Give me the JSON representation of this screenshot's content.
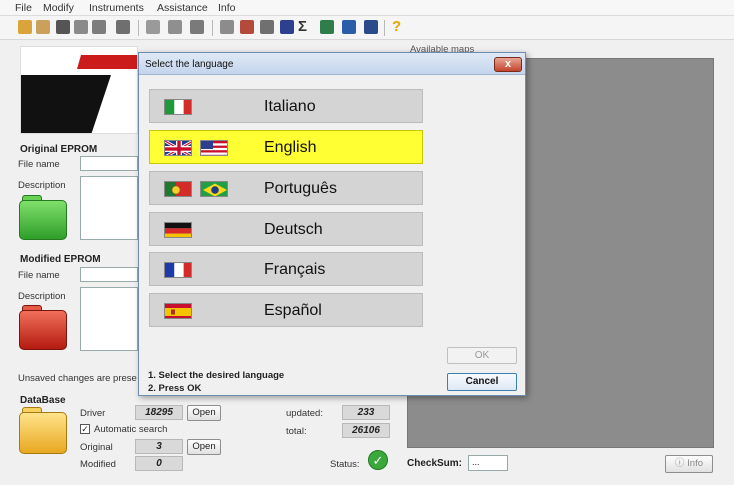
{
  "menu": {
    "file": "File",
    "modify": "Modify",
    "instruments": "Instruments",
    "assistance": "Assistance",
    "info": "Info"
  },
  "toolbar": {
    "icons": [
      "open-folder",
      "open-folder-2",
      "save",
      "grid-view",
      "hex-view",
      "tools",
      "window",
      "table",
      "copy",
      "compare",
      "eraser",
      "calculator",
      "uk-flag",
      "sigma",
      "book",
      "id-card",
      "shield",
      "help"
    ],
    "sigma_label": "Σ",
    "help_label": "?"
  },
  "original_eprom": {
    "title": "Original EPROM",
    "file_name_label": "File name",
    "description_label": "Description"
  },
  "modified_eprom": {
    "title": "Modified EPROM",
    "file_name_label": "File name",
    "description_label": "Description"
  },
  "unsaved_text": "Unsaved changes are prese",
  "database": {
    "title": "DataBase",
    "driver_label": "Driver",
    "driver_value": "18295",
    "open_label": "Open",
    "automatic_search_label": "Automatic search",
    "automatic_search_checked": true,
    "original_label": "Original",
    "original_value": "3",
    "modified_label": "Modified",
    "modified_value": "0",
    "updated_label": "updated:",
    "updated_value": "233",
    "total_label": "total:",
    "total_value": "26106",
    "status_label": "Status:"
  },
  "maps": {
    "label": "Available maps"
  },
  "checksum": {
    "label": "CheckSum:",
    "value": "..."
  },
  "info_button_label": "Info",
  "dialog": {
    "title": "Select the language",
    "close_label": "x",
    "languages": [
      {
        "label": "Italiano",
        "flags": [
          "italy"
        ],
        "selected": false
      },
      {
        "label": "English",
        "flags": [
          "uk",
          "usa"
        ],
        "selected": true
      },
      {
        "label": "Português",
        "flags": [
          "portugal",
          "brazil"
        ],
        "selected": false
      },
      {
        "label": "Deutsch",
        "flags": [
          "germany"
        ],
        "selected": false
      },
      {
        "label": "Français",
        "flags": [
          "france"
        ],
        "selected": false
      },
      {
        "label": "Español",
        "flags": [
          "spain"
        ],
        "selected": false
      }
    ],
    "instructions": [
      "1. Select the desired language",
      "2. Press OK"
    ],
    "ok_label": "OK",
    "cancel_label": "Cancel"
  },
  "colors": {
    "selected_language": "#ffff33",
    "language_button": "#d4d4d4",
    "maps_area": "#8c8c8c",
    "status_ok": "#3aa83a"
  }
}
